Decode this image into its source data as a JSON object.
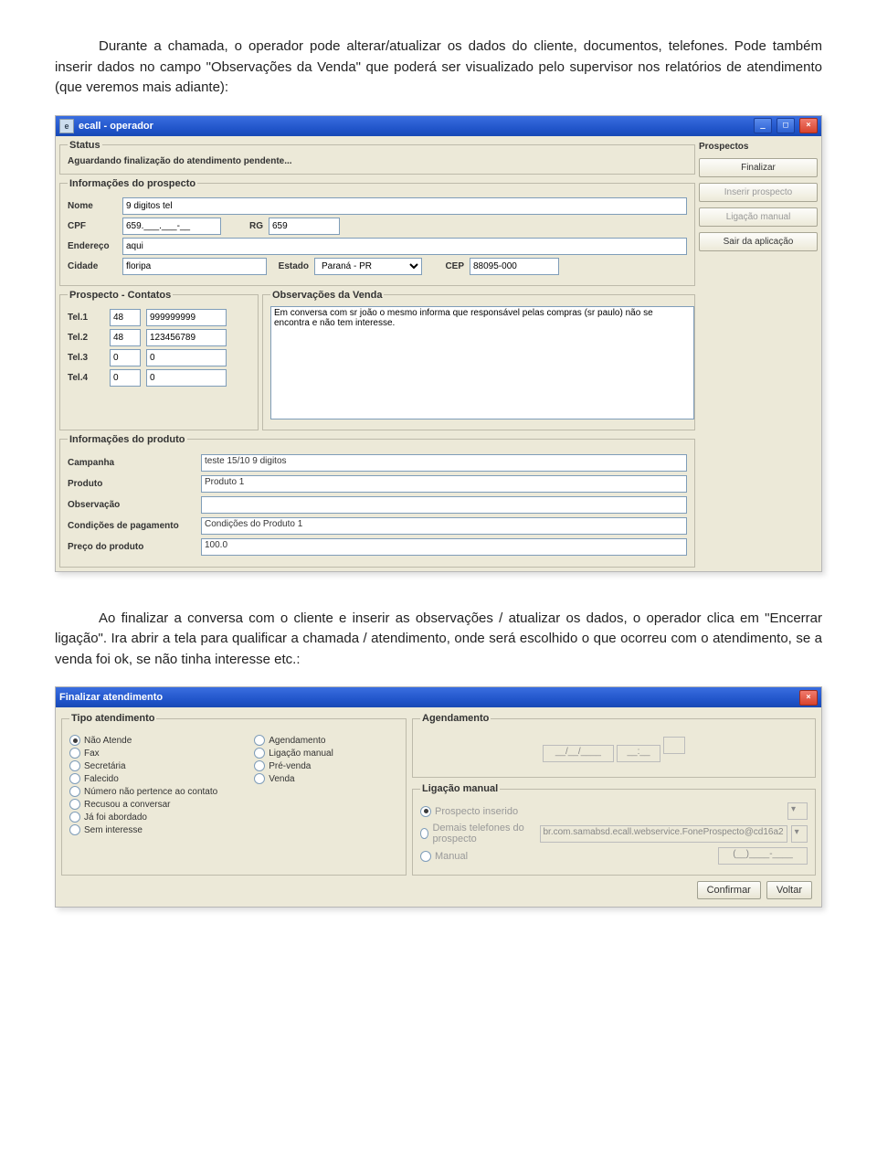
{
  "para1": "Durante a chamada, o operador pode alterar/atualizar os dados do cliente, documentos, telefones. Pode também inserir dados no campo \"Observações da Venda\" que poderá ser visualizado pelo supervisor nos relatórios de atendimento (que veremos mais adiante):",
  "para2": "Ao finalizar a conversa com o cliente e inserir as observações / atualizar os dados, o operador clica em \"Encerrar ligação\". Ira abrir a tela para qualificar a chamada / atendimento, onde será escolhido o que ocorreu com o atendimento, se a venda foi ok, se não tinha interesse etc.:",
  "operador": {
    "title": "ecall - operador",
    "status_label": "Status",
    "status_text": "Aguardando finalização do atendimento pendente...",
    "info_label": "Informações do prospecto",
    "nome_lbl": "Nome",
    "nome": "9 digitos tel",
    "cpf_lbl": "CPF",
    "cpf": "659.___.___-__",
    "rg_lbl": "RG",
    "rg": "659",
    "endereco_lbl": "Endereço",
    "endereco": "aqui",
    "cidade_lbl": "Cidade",
    "cidade": "floripa",
    "estado_lbl": "Estado",
    "estado": "Paraná - PR",
    "cep_lbl": "CEP",
    "cep": "88095-000",
    "contatos_label": "Prospecto - Contatos",
    "tel": [
      {
        "lbl": "Tel.1",
        "ddd": "48",
        "num": "999999999"
      },
      {
        "lbl": "Tel.2",
        "ddd": "48",
        "num": "123456789"
      },
      {
        "lbl": "Tel.3",
        "ddd": "0",
        "num": "0"
      },
      {
        "lbl": "Tel.4",
        "ddd": "0",
        "num": "0"
      }
    ],
    "obs_label": "Observações da Venda",
    "obs_text": "Em conversa com sr joão o mesmo informa que responsável pelas compras (sr paulo) não se encontra e não tem interesse.",
    "info_produto_label": "Informações do produto",
    "produto": {
      "campanha_lbl": "Campanha",
      "campanha": "teste 15/10 9 digitos",
      "produto_lbl": "Produto",
      "produto": "Produto 1",
      "observacao_lbl": "Observação",
      "observacao": "",
      "cond_lbl": "Condições de pagamento",
      "cond": "Condições do Produto 1",
      "preco_lbl": "Preço do produto",
      "preco": "100.0"
    },
    "prospects_label": "Prospectos",
    "btns": {
      "finalizar": "Finalizar",
      "inserir": "Inserir prospecto",
      "ligacao": "Ligação manual",
      "sair": "Sair da aplicação"
    }
  },
  "finalizar": {
    "title": "Finalizar atendimento",
    "tipo_label": "Tipo atendimento",
    "left_opts": [
      "Não Atende",
      "Fax",
      "Secretária",
      "Falecido",
      "Número não pertence ao contato",
      "Recusou a conversar",
      "Já foi abordado",
      "Sem interesse"
    ],
    "right_opts": [
      "Agendamento",
      "Ligação manual",
      "Pré-venda",
      "Venda"
    ],
    "selected": "Não Atende",
    "agendamento_label": "Agendamento",
    "ag_date": "__/__/____",
    "ag_time": "__:__",
    "lig_label": "Ligação manual",
    "lig_opts": {
      "prospecto": "Prospecto inserido",
      "demais": "Demais telefones do prospecto",
      "demais_val": "br.com.samabsd.ecall.webservice.FoneProspecto@cd16a2",
      "manual": "Manual",
      "manual_val": "(__)____-____"
    },
    "confirmar": "Confirmar",
    "voltar": "Voltar"
  }
}
